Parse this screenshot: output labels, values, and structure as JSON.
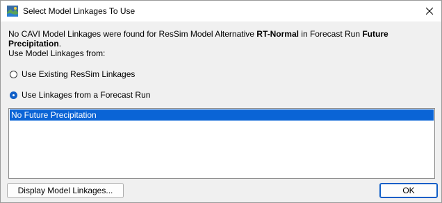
{
  "window": {
    "title": "Select Model Linkages To Use",
    "icon": "cavi-app-icon",
    "close_icon": "close-icon"
  },
  "message": {
    "part1": "No CAVI Model Linkages were found for ResSim Model Alternative ",
    "alternative": "RT-Normal",
    "part2": " in Forecast Run ",
    "forecast_run": "Future Precipitation",
    "part3": ".",
    "prompt": "Use Model Linkages from:"
  },
  "options": [
    {
      "label": "Use Existing ResSim Linkages",
      "selected": false
    },
    {
      "label": "Use Linkages from a Forecast Run",
      "selected": true
    }
  ],
  "list": {
    "items": [
      "No Future Precipitation"
    ],
    "selected_index": 0
  },
  "buttons": {
    "display_linkages": "Display Model Linkages...",
    "ok": "OK"
  },
  "colors": {
    "selection": "#0a64d6",
    "accent": "#0f5ec7"
  }
}
